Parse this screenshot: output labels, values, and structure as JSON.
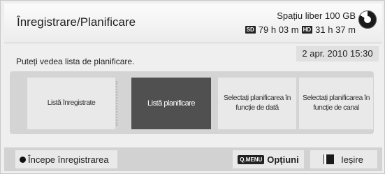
{
  "header": {
    "title": "Înregistrare/Planificare",
    "free_space_label": "Spațiu liber 100 GB",
    "sd_badge": "SD",
    "sd_time": "79 h 03 m",
    "hd_badge": "HD",
    "hd_time": "31 h 37 m",
    "storage_icon": "pie-chart-icon"
  },
  "datetime": "2 apr. 2010 15:30",
  "description": "Puteți vedea lista de planificare.",
  "options": [
    {
      "label": "Listă înregistrate",
      "selected": false
    },
    {
      "label": "Listă planificare",
      "selected": true
    },
    {
      "label": "Selectați planificarea în funcție de dată",
      "selected": false
    },
    {
      "label": "Selectați planificarea în funcție de canal",
      "selected": false
    }
  ],
  "footer": {
    "record_label": "Începe înregistrarea",
    "qmenu_badge": "Q.MENU",
    "options_label": "Opțiuni",
    "exit_label": "Ieșire"
  },
  "colors": {
    "selected_bg": "#505050",
    "panel_bg": "#d4d4d4"
  }
}
